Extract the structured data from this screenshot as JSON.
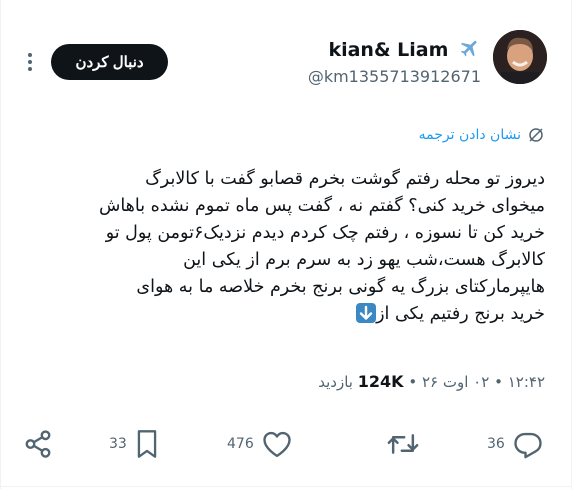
{
  "author": {
    "display_name": "kian& Liam",
    "handle": "@km1355713912671",
    "name_emoji_icon": "airplane-icon"
  },
  "follow_button": {
    "label": "دنبال کردن"
  },
  "translation": {
    "label": "نشان دادن ترجمه"
  },
  "tweet": {
    "text": "دیروز تو محله رفتم گوشت بخرم قصابو گفت با کالابرگ\nمیخوای خرید کنی؟ گفتم نه ، گفت پس ماه تموم نشده باهاش\nخرید کن تا نسوزه ، رفتم چک کردم دیدم نزدیک۶تومن پول تو\nکالابرگ هست،شب یهو زد به سرم برم از یکی این\nهایپرمارکتای بزرگ یه گونی برنج بخرم خلاصه ما به هوای\nخرید برنج رفتیم یکی از",
    "trailing_emoji": "down-arrow-emoji-icon"
  },
  "meta": {
    "time": "۱۲:۴۲",
    "separator": "•",
    "date": "۰۲ اوت ۲۶",
    "views": "124K",
    "views_label": "بازدید"
  },
  "actions": {
    "replies": "36",
    "retweets": "",
    "likes": "476",
    "bookmarks": "33"
  },
  "colors": {
    "accent": "#1d9bf0",
    "text": "#0f1419",
    "secondary": "#536471",
    "airplane": "#6ea8d8"
  }
}
